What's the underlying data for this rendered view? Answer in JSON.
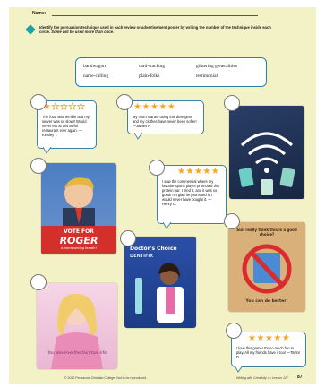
{
  "header": {
    "name_label": "Name:"
  },
  "instructions": {
    "text_main": "Identify the persuasion technique used in each review or advertisement poster by writing the number of the technique inside each circle.",
    "text_emphasis": "Some will be used more than once."
  },
  "word_bank": {
    "terms": [
      "bandwagon",
      "card-stacking",
      "glittering generalities",
      "name-calling",
      "plain-folks",
      "testimonial"
    ]
  },
  "reviews": [
    {
      "rating": 1,
      "text": "The food was terrible and my server was so slow!! Would never eat at this awful restaurant ever again. —Kinsley T."
    },
    {
      "rating": 5,
      "text": "My mom started using this detergent and my clothes have never been softer! —James R."
    },
    {
      "rating": 5,
      "text": "I saw the commercial where my favorite sports player promoted this protein bar. I tried it, and it was so good! I'm glad he promoted it; I would never have bought it. —Henry U."
    },
    {
      "rating": 5,
      "text": "I love this game! It's so much fun to play. All my friends have it too! —Taylor D."
    }
  ],
  "posters": {
    "roger_title": "VOTE FOR",
    "roger_name": "ROGER",
    "roger_sub": "A hardworking leader!",
    "doctor_title": "Doctor's Choice",
    "doctor_brand": "DENTIFIX",
    "sign_top": "Sun really think this is a good choice?",
    "sign_bottom": "You can do better!",
    "princess_caption": "You deserve the fairytale life"
  },
  "footer": {
    "copyright": "© 2022 Pensacola Christian College. Not to be reproduced.",
    "lesson": "Writing with Creativity II • Lesson 127",
    "page_number": "87"
  },
  "colors": {
    "accent": "#17a3a5",
    "border": "#2a7fa8",
    "star": "#f3a720",
    "page": "#f3f1c6"
  }
}
